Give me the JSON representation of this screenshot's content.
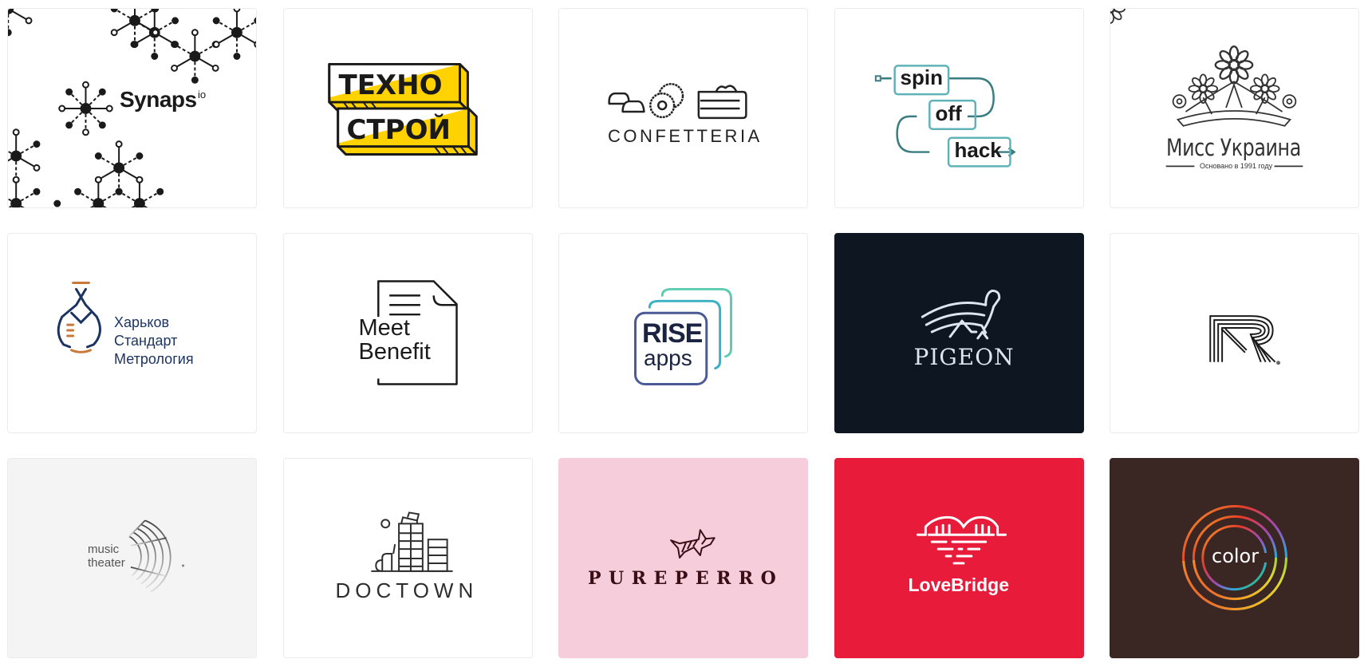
{
  "gallery": {
    "cards": [
      {
        "name": "Synaps",
        "wordmark": "Synaps",
        "superscript": "io",
        "background": "#ffffff",
        "ink": "#1a1a1a"
      },
      {
        "name": "Техно Строй",
        "line1": "ТЕХНО",
        "line2": "СТРОЙ",
        "background": "#ffffff",
        "accent": "#ffd200",
        "ink": "#1a1a1a"
      },
      {
        "name": "Confetteria",
        "wordmark": "CONFETTERIA",
        "background": "#ffffff",
        "ink": "#222222"
      },
      {
        "name": "Spin off hack",
        "words": [
          "spin",
          "off",
          "hack"
        ],
        "background": "#ffffff",
        "accent": "#3fa3a8",
        "ink": "#1a1a1a"
      },
      {
        "name": "Мисс Украина",
        "wordmark": "Мисс Украина",
        "tagline": "Основано в 1991 году",
        "background": "#ffffff",
        "ink": "#333333"
      },
      {
        "name": "Харьков Стандарт Метрология",
        "lines": [
          "Харьков",
          "Стандарт",
          "Метрология"
        ],
        "background": "#ffffff",
        "ink": "#1d3461",
        "accent": "#c9783c"
      },
      {
        "name": "Meet Benefit",
        "line1": "Meet",
        "line2": "Benefit",
        "background": "#ffffff",
        "ink": "#1a1a1a"
      },
      {
        "name": "RISE apps",
        "line1": "RISE",
        "line2": "apps",
        "background": "#ffffff",
        "ink": "#1a2340",
        "accent": "#4a5a96",
        "accent2": "#3cb0c4",
        "accent3": "#5ccdb0"
      },
      {
        "name": "Pigeon",
        "wordmark": "PIGEON",
        "background": "#0d1621",
        "ink": "#dde6ef"
      },
      {
        "name": "R monogram",
        "letter": "R",
        "mark": "®",
        "background": "#ffffff",
        "ink": "#1a1a1a"
      },
      {
        "name": "Music Theater",
        "line1": "music",
        "line2": "theater",
        "mark": "®",
        "background": "#f4f4f4",
        "ink": "#555555"
      },
      {
        "name": "Doctown",
        "wordmark": "DOCTOWN",
        "background": "#ffffff",
        "ink": "#2e2e2e"
      },
      {
        "name": "Pureperro",
        "wordmark": "PUREPERRO",
        "background": "#f6cedb",
        "ink": "#3a0d17"
      },
      {
        "name": "LoveBridge",
        "wordmark": "LoveBridge",
        "background": "#e81b3b",
        "ink": "#ffffff"
      },
      {
        "name": "Color",
        "wordmark": "color",
        "background": "#3a2622",
        "ink": "#ffffff"
      }
    ]
  }
}
